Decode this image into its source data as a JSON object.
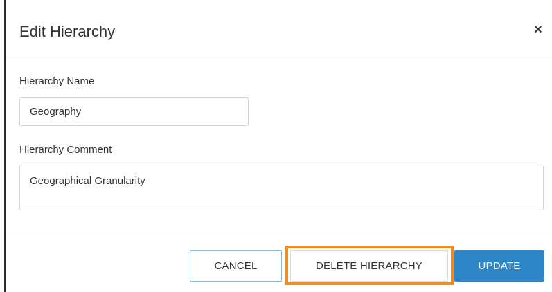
{
  "dialog": {
    "title": "Edit Hierarchy",
    "close_symbol": "×"
  },
  "form": {
    "name_label": "Hierarchy Name",
    "name_value": "Geography",
    "comment_label": "Hierarchy Comment",
    "comment_value": "Geographical Granularity"
  },
  "footer": {
    "cancel_label": "CANCEL",
    "delete_label": "DELETE HIERARCHY",
    "update_label": "UPDATE"
  },
  "colors": {
    "primary": "#2f86c6",
    "highlight": "#f28c1e"
  }
}
